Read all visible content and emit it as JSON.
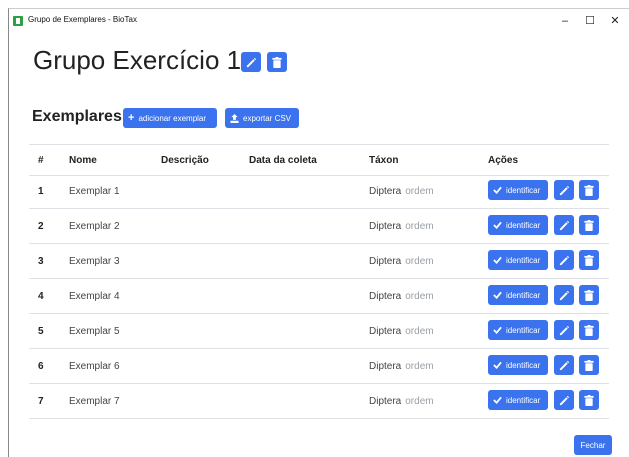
{
  "window": {
    "title": "Grupo de Exemplares - BioTax",
    "minimize": "–",
    "maximize": "☐",
    "close": "✕"
  },
  "page": {
    "title": "Grupo Exercício 1"
  },
  "section": {
    "title": "Exemplares",
    "add_label": "adicionar exemplar",
    "csv_label": "exportar CSV"
  },
  "table": {
    "headers": {
      "num": "#",
      "nome": "Nome",
      "descricao": "Descrição",
      "data": "Data da coleta",
      "taxon": "Táxon",
      "acoes": "Ações"
    },
    "identify_label": "identificar",
    "rows": [
      {
        "num": "1",
        "nome": "Exemplar 1",
        "descricao": "",
        "data": "",
        "taxon": "Diptera",
        "rank": "ordem"
      },
      {
        "num": "2",
        "nome": "Exemplar 2",
        "descricao": "",
        "data": "",
        "taxon": "Diptera",
        "rank": "ordem"
      },
      {
        "num": "3",
        "nome": "Exemplar 3",
        "descricao": "",
        "data": "",
        "taxon": "Diptera",
        "rank": "ordem"
      },
      {
        "num": "4",
        "nome": "Exemplar 4",
        "descricao": "",
        "data": "",
        "taxon": "Diptera",
        "rank": "ordem"
      },
      {
        "num": "5",
        "nome": "Exemplar 5",
        "descricao": "",
        "data": "",
        "taxon": "Diptera",
        "rank": "ordem"
      },
      {
        "num": "6",
        "nome": "Exemplar 6",
        "descricao": "",
        "data": "",
        "taxon": "Diptera",
        "rank": "ordem"
      },
      {
        "num": "7",
        "nome": "Exemplar 7",
        "descricao": "",
        "data": "",
        "taxon": "Diptera",
        "rank": "ordem"
      }
    ]
  },
  "footer": {
    "close_label": "Fechar"
  },
  "colors": {
    "primary": "#3b72ee",
    "app_icon": "#2ea043"
  }
}
